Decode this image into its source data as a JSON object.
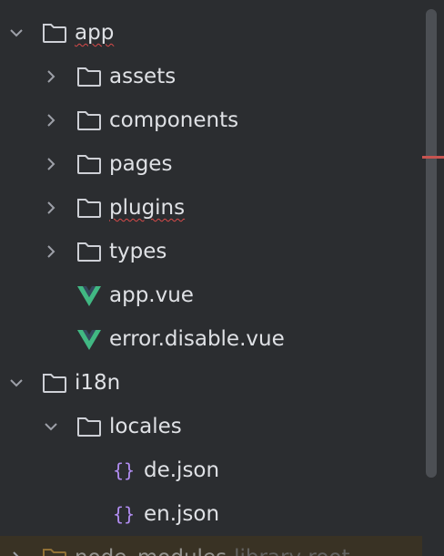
{
  "colors": {
    "background": "#2b2d30",
    "text": "#dfe1e5",
    "chevron": "#9da0a8",
    "folder_icon": "#ced0d6",
    "vue_light": "#41b883",
    "vue_dark": "#35495e",
    "json_icon": "#b08cf0",
    "error_marker": "#c75450",
    "highlight_row": "#393224"
  },
  "tree": {
    "items": [
      {
        "label": "app",
        "type": "folder",
        "depth": 0,
        "expanded": true
      },
      {
        "label": "assets",
        "type": "folder",
        "depth": 1,
        "expanded": false
      },
      {
        "label": "components",
        "type": "folder",
        "depth": 1,
        "expanded": false
      },
      {
        "label": "pages",
        "type": "folder",
        "depth": 1,
        "expanded": false
      },
      {
        "label": "plugins",
        "type": "folder",
        "depth": 1,
        "expanded": false
      },
      {
        "label": "types",
        "type": "folder",
        "depth": 1,
        "expanded": false
      },
      {
        "label": "app.vue",
        "type": "vue-file",
        "depth": 1
      },
      {
        "label": "error.disable.vue",
        "type": "vue-file",
        "depth": 1
      },
      {
        "label": "i18n",
        "type": "folder",
        "depth": 0,
        "expanded": true
      },
      {
        "label": "locales",
        "type": "folder",
        "depth": 1,
        "expanded": true
      },
      {
        "label": "de.json",
        "type": "json-file",
        "depth": 2
      },
      {
        "label": "en.json",
        "type": "json-file",
        "depth": 2
      },
      {
        "label": "node_modules",
        "suffix": "library root",
        "type": "folder",
        "depth": 0,
        "expanded": false
      }
    ]
  }
}
